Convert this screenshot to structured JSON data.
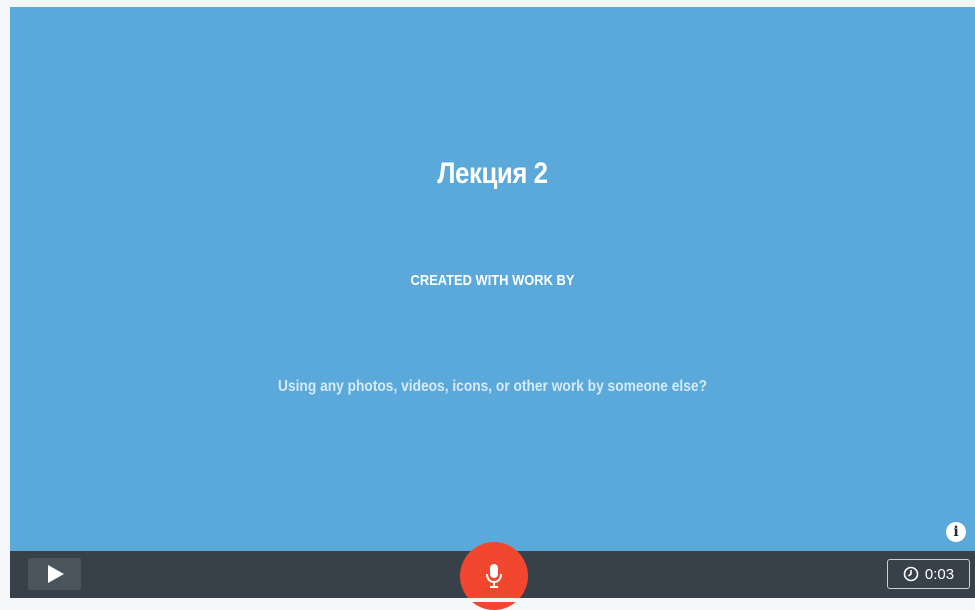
{
  "slide": {
    "title": "Лекция 2",
    "subtitle": "CREATED WITH WORK BY",
    "note": "Using any photos, videos, icons, or other work by someone else?",
    "background_color": "#5aa9da",
    "info_icon": "info-icon"
  },
  "controls": {
    "play_icon": "play-icon",
    "mic_icon": "microphone-icon",
    "mic_color": "#f0472e",
    "timer_icon": "clock-icon",
    "timer_value": "0:03"
  }
}
